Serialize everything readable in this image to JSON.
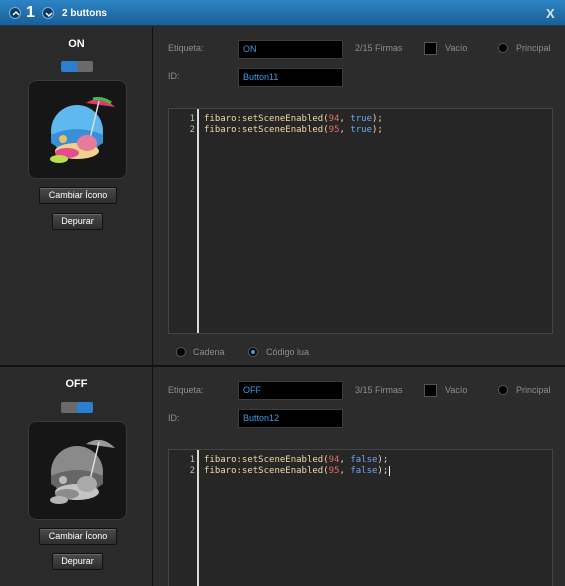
{
  "titlebar": {
    "number": "1",
    "title": "2 buttons",
    "close": "X"
  },
  "labels": {
    "etiqueta": "Etiqueta:",
    "id": "ID:",
    "vacio": "Vacío",
    "principal": "Principal",
    "cadena": "Cadena",
    "codigo_lua": "Código lua",
    "change_icon": "Cambiar Ícono",
    "debug": "Depurar"
  },
  "buttons": [
    {
      "title": "ON",
      "label_value": "ON",
      "firmas": "2/15 Firmas",
      "id_value": "Button11",
      "code_lines": [
        {
          "n": "1",
          "fn": "fibaro:setSceneEnabled",
          "arg1": "94",
          "arg2": "true"
        },
        {
          "n": "2",
          "fn": "fibaro:setSceneEnabled",
          "arg1": "95",
          "arg2": "true"
        }
      ]
    },
    {
      "title": "OFF",
      "label_value": "OFF",
      "firmas": "3/15 Firmas",
      "id_value": "Button12",
      "code_lines": [
        {
          "n": "1",
          "fn": "fibaro:setSceneEnabled",
          "arg1": "94",
          "arg2": "false"
        },
        {
          "n": "2",
          "fn": "fibaro:setSceneEnabled",
          "arg1": "95",
          "arg2": "false"
        }
      ]
    }
  ],
  "colors": {
    "accent": "#2d84c4",
    "field_text": "#3c9be6",
    "number": "#e06c6c",
    "keyword": "#6ca8f0"
  },
  "code_mode": "Código lua"
}
